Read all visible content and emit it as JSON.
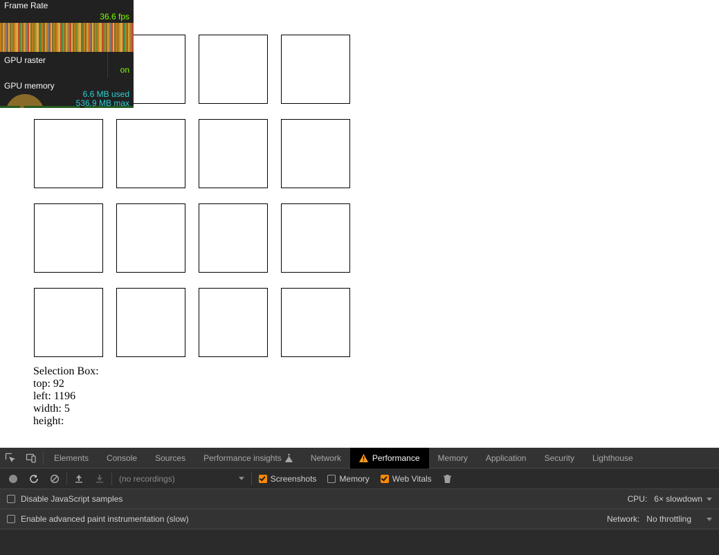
{
  "hud": {
    "frame_rate_label": "Frame Rate",
    "frame_rate_value": "36.6 fps",
    "gpu_raster_label": "GPU raster",
    "gpu_raster_value": "on",
    "gpu_memory_label": "GPU memory",
    "gpu_memory_used": "6.6 MB used",
    "gpu_memory_max": "536.9 MB max"
  },
  "selection": {
    "title": "Selection Box:",
    "top_label": "top: 92",
    "left_label": "left: 1196",
    "width_label": "width: 5",
    "height_label": "height:"
  },
  "devtools": {
    "tabs": {
      "elements": "Elements",
      "console": "Console",
      "sources": "Sources",
      "perf_insights": "Performance insights",
      "network": "Network",
      "performance": "Performance",
      "memory": "Memory",
      "application": "Application",
      "security": "Security",
      "lighthouse": "Lighthouse"
    },
    "toolbar": {
      "recordings_placeholder": "(no recordings)",
      "screenshots": "Screenshots",
      "memory": "Memory",
      "web_vitals": "Web Vitals"
    },
    "settings": {
      "disable_js": "Disable JavaScript samples",
      "advanced_paint": "Enable advanced paint instrumentation (slow)",
      "cpu_label": "CPU:",
      "cpu_value": "6× slowdown",
      "net_label": "Network:",
      "net_value": "No throttling"
    }
  }
}
